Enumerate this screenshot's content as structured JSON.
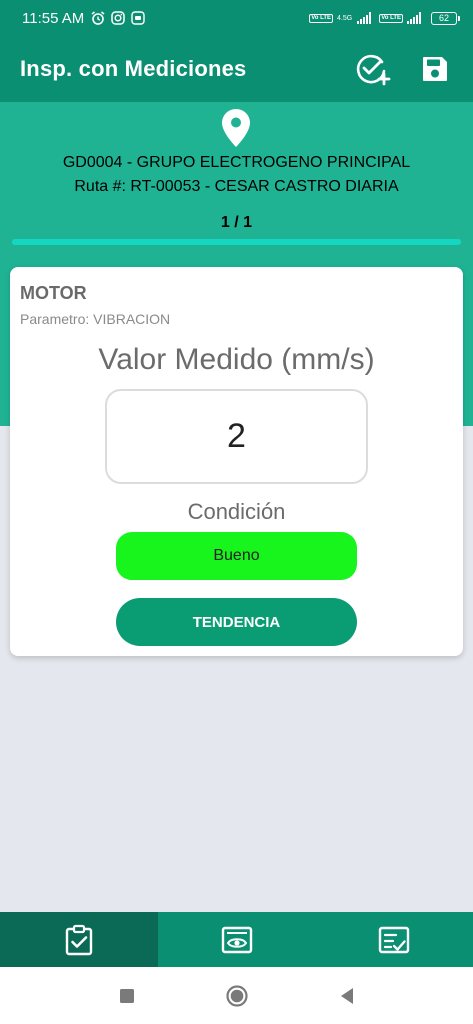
{
  "status_bar": {
    "time": "11:55 AM",
    "net_badge_1": "Vo LTE",
    "net_tag": "4.5G",
    "net_badge_2": "Vo LTE",
    "battery": "62"
  },
  "app_bar": {
    "title": "Insp. con Mediciones",
    "icons": [
      "add-check-icon",
      "save-icon"
    ]
  },
  "header": {
    "equipment": "GD0004 - GRUPO ELECTROGENO PRINCIPAL",
    "route": "Ruta #: RT-00053 - CESAR CASTRO DIARIA",
    "counter": "1 / 1",
    "progress": 1.0,
    "icon": "location-pin-icon"
  },
  "card": {
    "title": "MOTOR",
    "parameter": "Parametro: VIBRACION",
    "measure_label": "Valor Medido (mm/s)",
    "value": "2",
    "condition_label": "Condición",
    "condition_value": "Bueno",
    "trend_button": "TENDENCIA"
  },
  "bottom_nav": {
    "tabs": [
      "clipboard-check-icon",
      "view-icon",
      "checklist-icon"
    ],
    "active_index": 0
  },
  "system_nav": [
    "recents-icon",
    "home-icon",
    "back-icon"
  ],
  "colors": {
    "primary": "#0a8f72",
    "header": "#1fb394",
    "progress": "#14d7c2",
    "condition_good": "#17f51c",
    "button": "#0a9d74"
  }
}
